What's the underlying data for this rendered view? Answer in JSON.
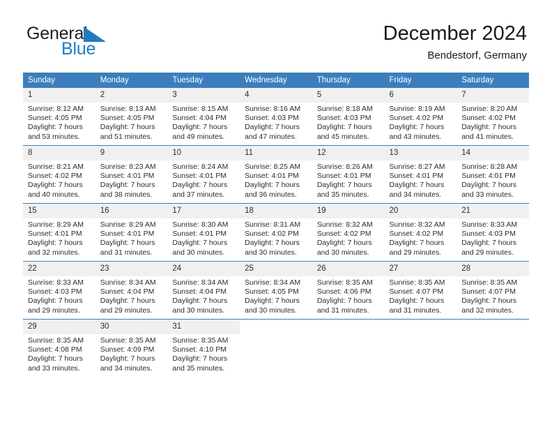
{
  "brand": {
    "name_part1": "General",
    "name_part2": "Blue",
    "flag_icon": "triangle-flag-icon",
    "color_dark": "#221f1f",
    "color_blue": "#1f7cc0"
  },
  "header": {
    "title": "December 2024",
    "subtitle": "Bendestorf, Germany"
  },
  "theme": {
    "header_bg": "#3c7ebd",
    "header_text": "#ffffff",
    "daynum_bg": "#f0f0f0",
    "body_text": "#2c2c2c",
    "separator": "#3c7ebd"
  },
  "weekday_headers": [
    "Sunday",
    "Monday",
    "Tuesday",
    "Wednesday",
    "Thursday",
    "Friday",
    "Saturday"
  ],
  "weeks": [
    [
      {
        "day": "1",
        "sunrise": "Sunrise: 8:12 AM",
        "sunset": "Sunset: 4:05 PM",
        "daylight_1": "Daylight: 7 hours",
        "daylight_2": "and 53 minutes."
      },
      {
        "day": "2",
        "sunrise": "Sunrise: 8:13 AM",
        "sunset": "Sunset: 4:05 PM",
        "daylight_1": "Daylight: 7 hours",
        "daylight_2": "and 51 minutes."
      },
      {
        "day": "3",
        "sunrise": "Sunrise: 8:15 AM",
        "sunset": "Sunset: 4:04 PM",
        "daylight_1": "Daylight: 7 hours",
        "daylight_2": "and 49 minutes."
      },
      {
        "day": "4",
        "sunrise": "Sunrise: 8:16 AM",
        "sunset": "Sunset: 4:03 PM",
        "daylight_1": "Daylight: 7 hours",
        "daylight_2": "and 47 minutes."
      },
      {
        "day": "5",
        "sunrise": "Sunrise: 8:18 AM",
        "sunset": "Sunset: 4:03 PM",
        "daylight_1": "Daylight: 7 hours",
        "daylight_2": "and 45 minutes."
      },
      {
        "day": "6",
        "sunrise": "Sunrise: 8:19 AM",
        "sunset": "Sunset: 4:02 PM",
        "daylight_1": "Daylight: 7 hours",
        "daylight_2": "and 43 minutes."
      },
      {
        "day": "7",
        "sunrise": "Sunrise: 8:20 AM",
        "sunset": "Sunset: 4:02 PM",
        "daylight_1": "Daylight: 7 hours",
        "daylight_2": "and 41 minutes."
      }
    ],
    [
      {
        "day": "8",
        "sunrise": "Sunrise: 8:21 AM",
        "sunset": "Sunset: 4:02 PM",
        "daylight_1": "Daylight: 7 hours",
        "daylight_2": "and 40 minutes."
      },
      {
        "day": "9",
        "sunrise": "Sunrise: 8:23 AM",
        "sunset": "Sunset: 4:01 PM",
        "daylight_1": "Daylight: 7 hours",
        "daylight_2": "and 38 minutes."
      },
      {
        "day": "10",
        "sunrise": "Sunrise: 8:24 AM",
        "sunset": "Sunset: 4:01 PM",
        "daylight_1": "Daylight: 7 hours",
        "daylight_2": "and 37 minutes."
      },
      {
        "day": "11",
        "sunrise": "Sunrise: 8:25 AM",
        "sunset": "Sunset: 4:01 PM",
        "daylight_1": "Daylight: 7 hours",
        "daylight_2": "and 36 minutes."
      },
      {
        "day": "12",
        "sunrise": "Sunrise: 8:26 AM",
        "sunset": "Sunset: 4:01 PM",
        "daylight_1": "Daylight: 7 hours",
        "daylight_2": "and 35 minutes."
      },
      {
        "day": "13",
        "sunrise": "Sunrise: 8:27 AM",
        "sunset": "Sunset: 4:01 PM",
        "daylight_1": "Daylight: 7 hours",
        "daylight_2": "and 34 minutes."
      },
      {
        "day": "14",
        "sunrise": "Sunrise: 8:28 AM",
        "sunset": "Sunset: 4:01 PM",
        "daylight_1": "Daylight: 7 hours",
        "daylight_2": "and 33 minutes."
      }
    ],
    [
      {
        "day": "15",
        "sunrise": "Sunrise: 8:29 AM",
        "sunset": "Sunset: 4:01 PM",
        "daylight_1": "Daylight: 7 hours",
        "daylight_2": "and 32 minutes."
      },
      {
        "day": "16",
        "sunrise": "Sunrise: 8:29 AM",
        "sunset": "Sunset: 4:01 PM",
        "daylight_1": "Daylight: 7 hours",
        "daylight_2": "and 31 minutes."
      },
      {
        "day": "17",
        "sunrise": "Sunrise: 8:30 AM",
        "sunset": "Sunset: 4:01 PM",
        "daylight_1": "Daylight: 7 hours",
        "daylight_2": "and 30 minutes."
      },
      {
        "day": "18",
        "sunrise": "Sunrise: 8:31 AM",
        "sunset": "Sunset: 4:02 PM",
        "daylight_1": "Daylight: 7 hours",
        "daylight_2": "and 30 minutes."
      },
      {
        "day": "19",
        "sunrise": "Sunrise: 8:32 AM",
        "sunset": "Sunset: 4:02 PM",
        "daylight_1": "Daylight: 7 hours",
        "daylight_2": "and 30 minutes."
      },
      {
        "day": "20",
        "sunrise": "Sunrise: 8:32 AM",
        "sunset": "Sunset: 4:02 PM",
        "daylight_1": "Daylight: 7 hours",
        "daylight_2": "and 29 minutes."
      },
      {
        "day": "21",
        "sunrise": "Sunrise: 8:33 AM",
        "sunset": "Sunset: 4:03 PM",
        "daylight_1": "Daylight: 7 hours",
        "daylight_2": "and 29 minutes."
      }
    ],
    [
      {
        "day": "22",
        "sunrise": "Sunrise: 8:33 AM",
        "sunset": "Sunset: 4:03 PM",
        "daylight_1": "Daylight: 7 hours",
        "daylight_2": "and 29 minutes."
      },
      {
        "day": "23",
        "sunrise": "Sunrise: 8:34 AM",
        "sunset": "Sunset: 4:04 PM",
        "daylight_1": "Daylight: 7 hours",
        "daylight_2": "and 29 minutes."
      },
      {
        "day": "24",
        "sunrise": "Sunrise: 8:34 AM",
        "sunset": "Sunset: 4:04 PM",
        "daylight_1": "Daylight: 7 hours",
        "daylight_2": "and 30 minutes."
      },
      {
        "day": "25",
        "sunrise": "Sunrise: 8:34 AM",
        "sunset": "Sunset: 4:05 PM",
        "daylight_1": "Daylight: 7 hours",
        "daylight_2": "and 30 minutes."
      },
      {
        "day": "26",
        "sunrise": "Sunrise: 8:35 AM",
        "sunset": "Sunset: 4:06 PM",
        "daylight_1": "Daylight: 7 hours",
        "daylight_2": "and 31 minutes."
      },
      {
        "day": "27",
        "sunrise": "Sunrise: 8:35 AM",
        "sunset": "Sunset: 4:07 PM",
        "daylight_1": "Daylight: 7 hours",
        "daylight_2": "and 31 minutes."
      },
      {
        "day": "28",
        "sunrise": "Sunrise: 8:35 AM",
        "sunset": "Sunset: 4:07 PM",
        "daylight_1": "Daylight: 7 hours",
        "daylight_2": "and 32 minutes."
      }
    ],
    [
      {
        "day": "29",
        "sunrise": "Sunrise: 8:35 AM",
        "sunset": "Sunset: 4:08 PM",
        "daylight_1": "Daylight: 7 hours",
        "daylight_2": "and 33 minutes."
      },
      {
        "day": "30",
        "sunrise": "Sunrise: 8:35 AM",
        "sunset": "Sunset: 4:09 PM",
        "daylight_1": "Daylight: 7 hours",
        "daylight_2": "and 34 minutes."
      },
      {
        "day": "31",
        "sunrise": "Sunrise: 8:35 AM",
        "sunset": "Sunset: 4:10 PM",
        "daylight_1": "Daylight: 7 hours",
        "daylight_2": "and 35 minutes."
      },
      {
        "day": "",
        "sunrise": "",
        "sunset": "",
        "daylight_1": "",
        "daylight_2": ""
      },
      {
        "day": "",
        "sunrise": "",
        "sunset": "",
        "daylight_1": "",
        "daylight_2": ""
      },
      {
        "day": "",
        "sunrise": "",
        "sunset": "",
        "daylight_1": "",
        "daylight_2": ""
      },
      {
        "day": "",
        "sunrise": "",
        "sunset": "",
        "daylight_1": "",
        "daylight_2": ""
      }
    ]
  ]
}
